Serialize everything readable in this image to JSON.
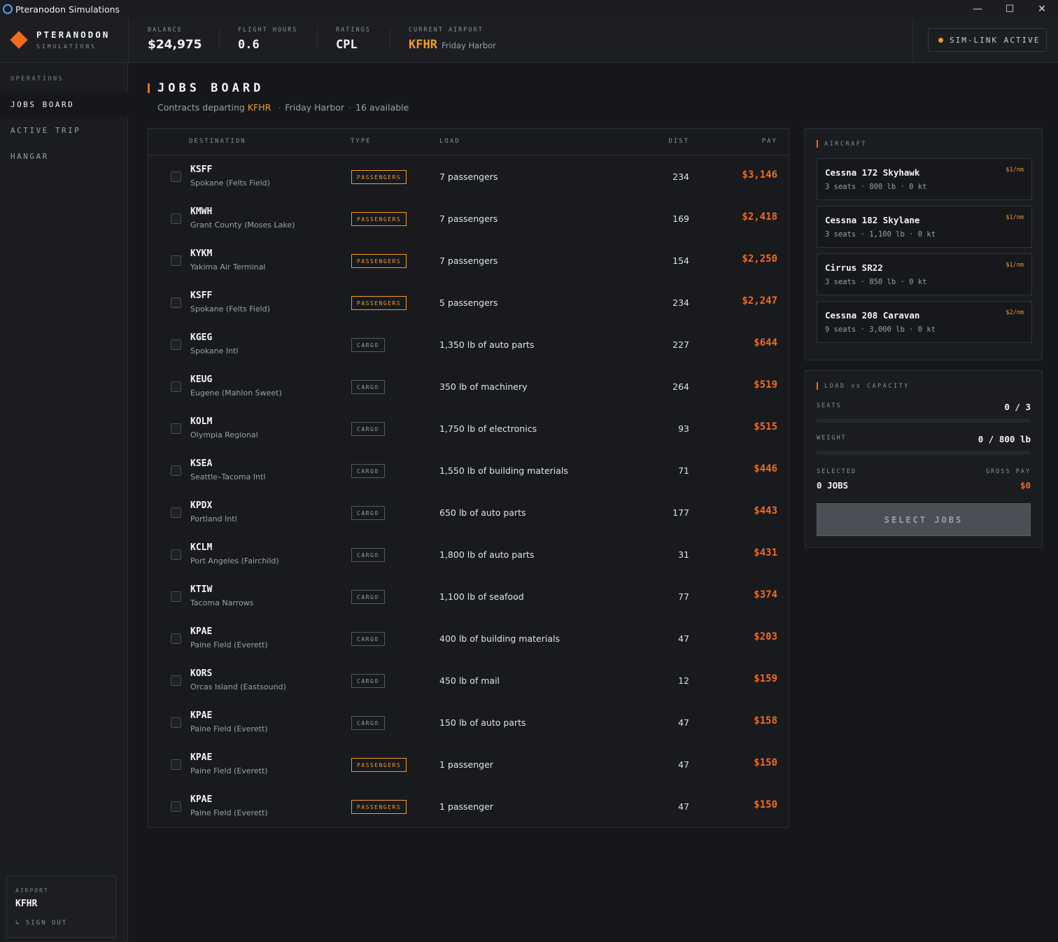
{
  "window": {
    "title": "Pteranodon Simulations",
    "minimize": "—",
    "maximize": "☐",
    "close": "✕"
  },
  "brand": {
    "name": "PTERANODON",
    "sub": "SIMULATIONS"
  },
  "header": {
    "balance_label": "BALANCE",
    "balance": "$24,975",
    "hours_label": "FLIGHT HOURS",
    "hours": "0.6",
    "ratings_label": "RATINGS",
    "ratings": "CPL",
    "airport_label": "CURRENT AIRPORT",
    "airport_code": "KFHR",
    "airport_name": "Friday Harbor",
    "simlink": "SIM-LINK ACTIVE"
  },
  "sidebar": {
    "section": "OPERATIONS",
    "items": [
      {
        "label": "JOBS BOARD"
      },
      {
        "label": "ACTIVE TRIP"
      },
      {
        "label": "HANGAR"
      }
    ],
    "airport_label": "AIRPORT",
    "airport_code": "KFHR",
    "signout": "↳ SIGN OUT"
  },
  "page": {
    "title": "JOBS BOARD",
    "sub_prefix": "Contracts departing",
    "sub_code": "KFHR",
    "sub_dot1": "·",
    "sub_name": "Friday Harbor",
    "sub_dot2": "·",
    "sub_count": "16 available"
  },
  "table": {
    "headers": {
      "destination": "DESTINATION",
      "type": "TYPE",
      "load": "LOAD",
      "dist": "DIST",
      "pay": "PAY"
    },
    "rows": [
      {
        "code": "KSFF",
        "name": "Spokane (Felts Field)",
        "type": "PASSENGERS",
        "load": "7 passengers",
        "dist": "234",
        "pay": "$3,146"
      },
      {
        "code": "KMWH",
        "name": "Grant County (Moses Lake)",
        "type": "PASSENGERS",
        "load": "7 passengers",
        "dist": "169",
        "pay": "$2,418"
      },
      {
        "code": "KYKM",
        "name": "Yakima Air Terminal",
        "type": "PASSENGERS",
        "load": "7 passengers",
        "dist": "154",
        "pay": "$2,250"
      },
      {
        "code": "KSFF",
        "name": "Spokane (Felts Field)",
        "type": "PASSENGERS",
        "load": "5 passengers",
        "dist": "234",
        "pay": "$2,247"
      },
      {
        "code": "KGEG",
        "name": "Spokane Intl",
        "type": "CARGO",
        "load": "1,350 lb of auto parts",
        "dist": "227",
        "pay": "$644"
      },
      {
        "code": "KEUG",
        "name": "Eugene (Mahlon Sweet)",
        "type": "CARGO",
        "load": "350 lb of machinery",
        "dist": "264",
        "pay": "$519"
      },
      {
        "code": "KOLM",
        "name": "Olympia Regional",
        "type": "CARGO",
        "load": "1,750 lb of electronics",
        "dist": "93",
        "pay": "$515"
      },
      {
        "code": "KSEA",
        "name": "Seattle–Tacoma Intl",
        "type": "CARGO",
        "load": "1,550 lb of building materials",
        "dist": "71",
        "pay": "$446"
      },
      {
        "code": "KPDX",
        "name": "Portland Intl",
        "type": "CARGO",
        "load": "650 lb of auto parts",
        "dist": "177",
        "pay": "$443"
      },
      {
        "code": "KCLM",
        "name": "Port Angeles (Fairchild)",
        "type": "CARGO",
        "load": "1,800 lb of auto parts",
        "dist": "31",
        "pay": "$431"
      },
      {
        "code": "KTIW",
        "name": "Tacoma Narrows",
        "type": "CARGO",
        "load": "1,100 lb of seafood",
        "dist": "77",
        "pay": "$374"
      },
      {
        "code": "KPAE",
        "name": "Paine Field (Everett)",
        "type": "CARGO",
        "load": "400 lb of building materials",
        "dist": "47",
        "pay": "$203"
      },
      {
        "code": "KORS",
        "name": "Orcas Island (Eastsound)",
        "type": "CARGO",
        "load": "450 lb of mail",
        "dist": "12",
        "pay": "$159"
      },
      {
        "code": "KPAE",
        "name": "Paine Field (Everett)",
        "type": "CARGO",
        "load": "150 lb of auto parts",
        "dist": "47",
        "pay": "$158"
      },
      {
        "code": "KPAE",
        "name": "Paine Field (Everett)",
        "type": "PASSENGERS",
        "load": "1 passenger",
        "dist": "47",
        "pay": "$150"
      },
      {
        "code": "KPAE",
        "name": "Paine Field (Everett)",
        "type": "PASSENGERS",
        "load": "1 passenger",
        "dist": "47",
        "pay": "$150"
      }
    ]
  },
  "aircraft": {
    "title": "AIRCRAFT",
    "items": [
      {
        "name": "Cessna 172 Skyhawk",
        "rate": "$1/nm",
        "spec": "3 seats · 800 lb · 0 kt"
      },
      {
        "name": "Cessna 182 Skylane",
        "rate": "$1/nm",
        "spec": "3 seats · 1,100 lb · 0 kt"
      },
      {
        "name": "Cirrus SR22",
        "rate": "$1/nm",
        "spec": "3 seats · 850 lb · 0 kt"
      },
      {
        "name": "Cessna 208 Caravan",
        "rate": "$2/nm",
        "spec": "9 seats · 3,000 lb · 0 kt"
      }
    ]
  },
  "capacity": {
    "title": "LOAD vs CAPACITY",
    "seats_label": "SEATS",
    "seats_value": "0 / 3",
    "seats_fraction": 0,
    "weight_label": "WEIGHT",
    "weight_value": "0 / 800 lb",
    "weight_fraction": 0,
    "selected_label": "SELECTED",
    "selected_value": "0 JOBS",
    "gross_label": "GROSS PAY",
    "gross_value": "$0",
    "button": "SELECT JOBS"
  },
  "colors": {
    "accent": "#f26b1d",
    "highlight": "#f59b1e",
    "bg": "#15171b"
  }
}
